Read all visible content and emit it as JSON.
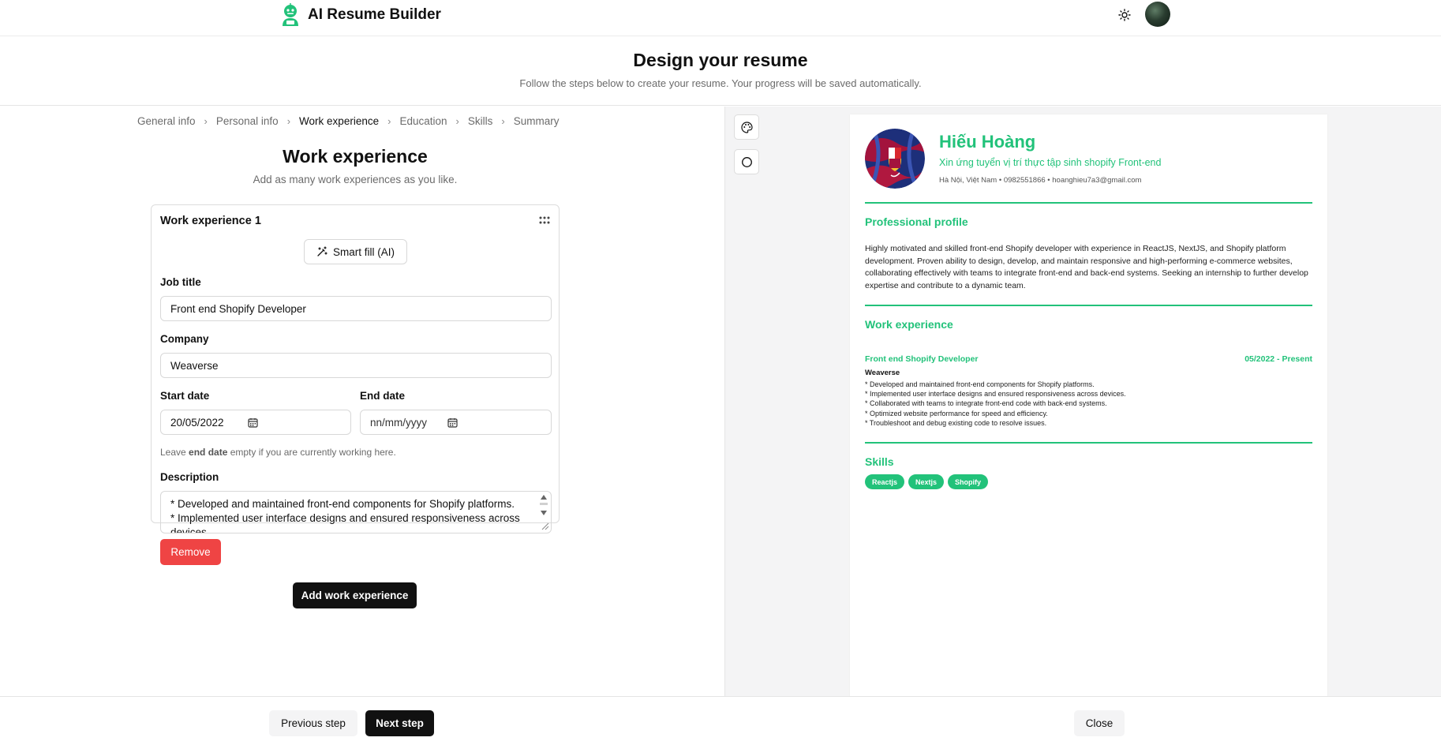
{
  "app": {
    "name": "AI Resume Builder",
    "logo_icon": "robot-logo-icon",
    "theme_icon": "sun-icon"
  },
  "header": {
    "title": "Design your resume",
    "subtitle": "Follow the steps below to create your resume. Your progress will be saved automatically."
  },
  "breadcrumb": {
    "items": [
      "General info",
      "Personal info",
      "Work experience",
      "Education",
      "Skills",
      "Summary"
    ],
    "active": "Work experience",
    "separator": "›"
  },
  "form": {
    "title": "Work experience",
    "subtitle": "Add as many work experiences as you like.",
    "entries": [
      {
        "heading": "Work experience 1",
        "smart_fill_label": "Smart fill (AI)",
        "job_title_label": "Job title",
        "job_title_value": "Front end Shopify Developer",
        "company_label": "Company",
        "company_value": "Weaverse",
        "start_date_label": "Start date",
        "start_date_value": "20/05/2022",
        "end_date_label": "End date",
        "end_date_placeholder": "nn/mm/yyyy",
        "hint_prefix": "Leave ",
        "hint_bold": "end date",
        "hint_suffix": " empty if you are currently working here.",
        "description_label": "Description",
        "description_lines": [
          "* Developed and maintained front-end components for Shopify platforms.",
          "* Implemented user interface designs and ensured responsiveness across",
          "devices."
        ],
        "remove_label": "Remove"
      }
    ],
    "add_label": "Add work experience"
  },
  "resume": {
    "name": "Hiếu Hoàng",
    "role": "Xin ứng tuyển vị trí thực tập sinh shopify Front-end",
    "contact": "Hà Nội, Việt Nam • 0982551866 • hoanghieu7a3@gmail.com",
    "profile_heading": "Professional profile",
    "profile_text": "Highly motivated and skilled front-end Shopify developer with experience in ReactJS, NextJS, and Shopify platform development. Proven ability to design, develop, and maintain responsive and high-performing e-commerce websites, collaborating effectively with teams to integrate front-end and back-end systems. Seeking an internship to further develop expertise and contribute to a dynamic team.",
    "work_heading": "Work experience",
    "job_title": "Front end Shopify Developer",
    "job_dates": "05/2022 - Present",
    "job_company": "Weaverse",
    "job_bullets": [
      "* Developed and maintained front-end components for Shopify platforms.",
      "* Implemented user interface designs and ensured responsiveness across devices.",
      "* Collaborated with teams to integrate front-end code with back-end systems.",
      "* Optimized website performance for speed and efficiency.",
      "* Troubleshoot and debug existing code to resolve issues."
    ],
    "skills_heading": "Skills",
    "skills": [
      "Reactjs",
      "Nextjs",
      "Shopify"
    ],
    "accent_color": "#22c27a"
  },
  "footer": {
    "previous_label": "Previous step",
    "next_label": "Next step",
    "close_label": "Close"
  },
  "colors": {
    "primary_button": "#111111",
    "danger_button": "#ef4444",
    "resume_accent": "#22c27a"
  }
}
